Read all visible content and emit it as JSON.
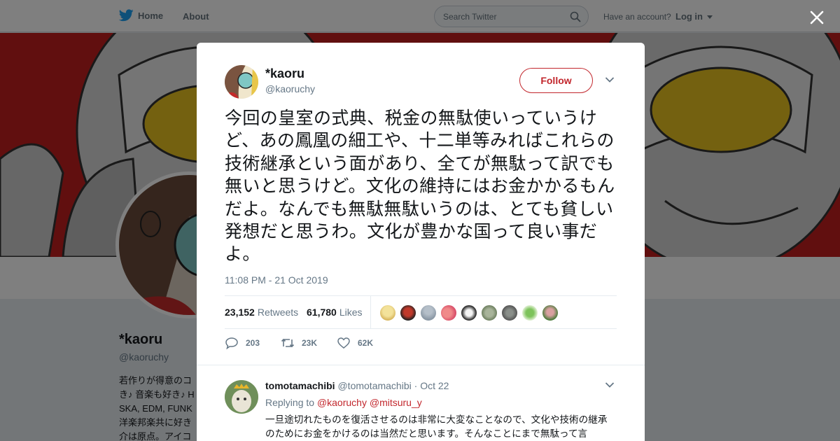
{
  "nav": {
    "home_label": "Home",
    "about_label": "About",
    "search_placeholder": "Search Twitter",
    "have_account": "Have an account?",
    "login_label": "Log in"
  },
  "profile": {
    "name": "*kaoru",
    "handle": "@kaoruchy",
    "bio_lines": [
      "若作りが得意のコ",
      "き♪ 音楽も好き♪ H",
      "SKA, EDM, FUNK",
      "洋楽邦楽共に好き",
      "介は原点。アイコ"
    ]
  },
  "tweet": {
    "name": "*kaoru",
    "handle": "@kaoruchy",
    "follow_label": "Follow",
    "text": "今回の皇室の式典、税金の無駄使いっていうけど、あの鳳凰の細工や、十二単等みればこれらの技術継承という面があり、全てが無駄って訳でも無いと思うけど。文化の維持にはお金かかるもんだよ。なんでも無駄無駄いうのは、とても貧しい発想だと思うわ。文化が豊かな国って良い事だよ。",
    "timestamp": "11:08 PM - 21 Oct 2019",
    "retweets_count": "23,152",
    "retweets_label": "Retweets",
    "likes_count": "61,780",
    "likes_label": "Likes",
    "reply_count": "203",
    "retweet_count_short": "23K",
    "like_count_short": "62K"
  },
  "reply": {
    "name": "tomotamachibi",
    "handle": "@tomotamachibi",
    "separator": "·",
    "date": "Oct 22",
    "replying_to_label": "Replying to",
    "mention_1": "@kaoruchy",
    "mention_2": "@mitsuru_y",
    "text": "一旦途切れたものを復活させるのは非常に大変なことなので、文化や技術の継承のためにお金をかけるのは当然だと思います。そんなことにまで無駄って言"
  },
  "colors": {
    "accent": "#c2272d",
    "twitter_blue": "#1da1f2",
    "banner": "#c21e1e",
    "muted_text": "#657786"
  },
  "icons": [
    "twitter-bird-icon",
    "search-icon",
    "caret-down-icon",
    "close-icon",
    "reply-icon",
    "retweet-icon",
    "heart-icon",
    "chevron-down-icon"
  ]
}
